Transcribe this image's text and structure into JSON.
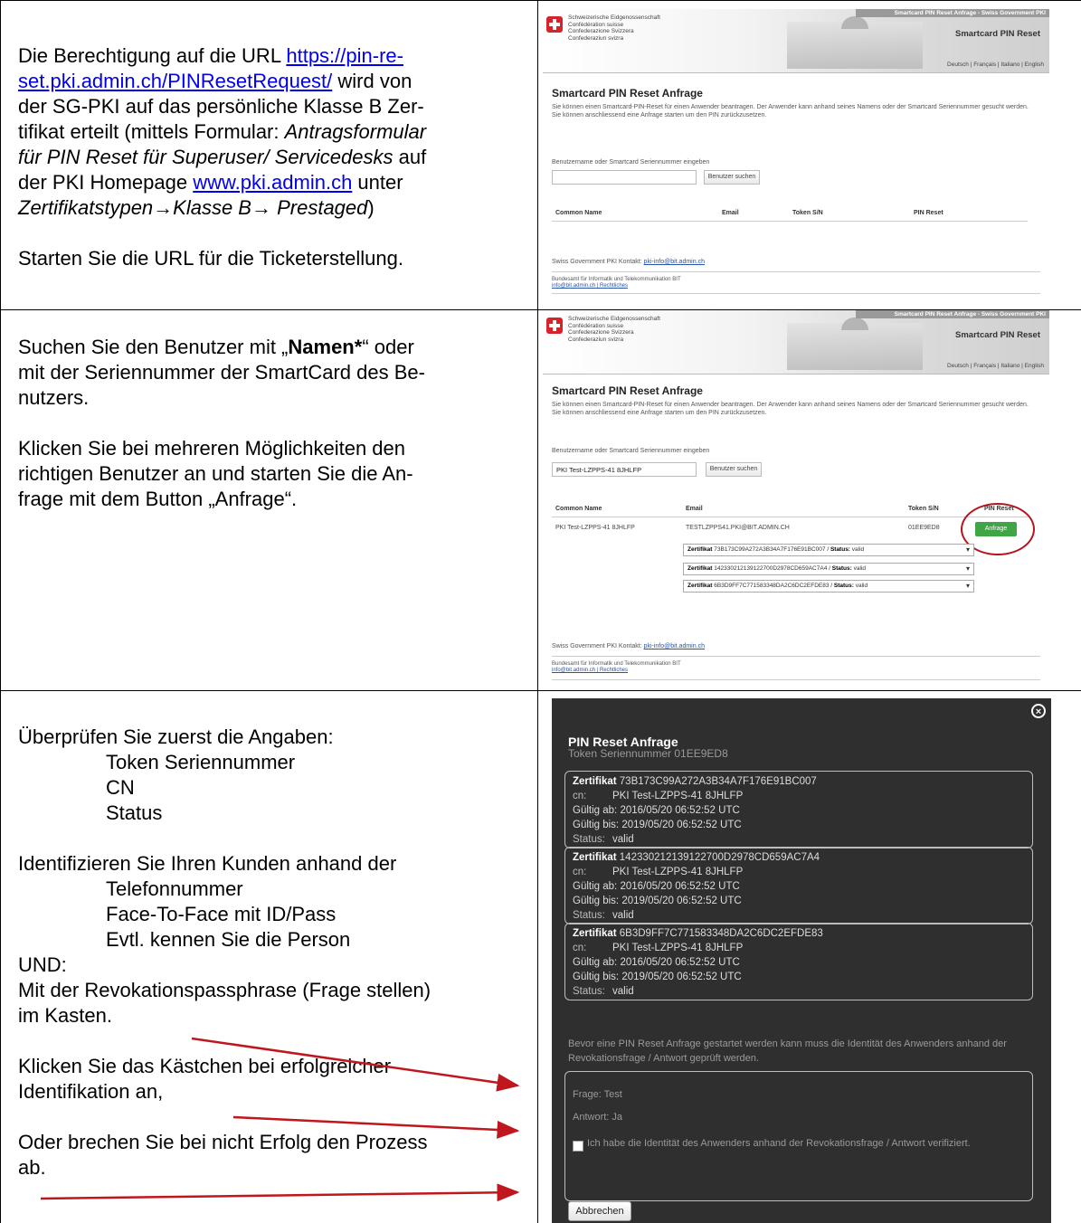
{
  "left": {
    "row1": {
      "line1_pre": "Die Berechtigung auf die URL ",
      "link1a": "https://pin-re-",
      "link1b": "set.pki.admin.ch/PINResetRequest/",
      "line2_post": " wird von",
      "line3": "der SG-PKI auf das persönliche Klasse B Zer-",
      "line4_pre": "tifikat erteilt (mittels Formular: ",
      "line4_em": "Antragsformular",
      "line5_em": "für PIN Reset für Superuser/ Servicedesks",
      "line5_post": " auf",
      "line6_pre": "der PKI Homepage ",
      "line6_link": "www.pki.admin.ch",
      "line6_post": " unter",
      "line7_em": "Zertifikatstypen→Klasse B→ Prestaged",
      "line7_post": ")",
      "line8": "Starten Sie die URL für die Ticketerstellung."
    },
    "row2": {
      "l1_pre": "Suchen Sie den Benutzer mit „",
      "l1_bold": "Namen*",
      "l1_post": "“ oder",
      "l2": "mit der Seriennummer der SmartCard des Be-",
      "l3": "nutzers.",
      "l4": "Klicken Sie bei mehreren Möglichkeiten den",
      "l5": "richtigen Benutzer an und starten Sie die An-",
      "l6": "frage mit dem Button „Anfrage“."
    },
    "row3": {
      "l1": "Überprüfen Sie zuerst die Angaben:",
      "l2": "Token Seriennummer",
      "l3": "CN",
      "l4": "Status",
      "l5": "Identifizieren Sie Ihren Kunden anhand der",
      "l6": "Telefonnummer",
      "l7": "Face-To-Face mit ID/Pass",
      "l8": "Evtl. kennen Sie die Person",
      "l9": "UND:",
      "l10": "Mit der Revokationspassphrase (Frage stellen)",
      "l11": "im Kasten.",
      "l12": "Klicken Sie das Kästchen bei erfolgreicher",
      "l13": "Identifikation an,",
      "l14": "Oder brechen Sie bei nicht Erfolg den Prozess",
      "l15": "ab."
    }
  },
  "portal": {
    "conf_lines": [
      "Schweizerische Eidgenossenschaft",
      "Confédération suisse",
      "Confederazione Svizzera",
      "Confederaziun svizra"
    ],
    "topbar": "Smartcard PIN Reset Anfrage - Swiss Government PKI",
    "app_title": "Smartcard PIN Reset",
    "langs": "Deutsch | Français | Italiano | English",
    "page_title": "Smartcard PIN Reset Anfrage",
    "desc1": "Sie können einen Smartcard-PIN-Reset für einen Anwender beantragen. Der Anwender kann anhand seines Namens oder der Smartcard Seriennummer gesucht werden. Sie können anschliessend eine Anfrage starten um den PIN zurückzusetzen.",
    "desc2": "Sie können einen Smartcard-PIN-Reset für einen Anwender beantragen. Der Anwender kann anhand seines Namens oder der Smartcard Seriennummer gesucht werden. Sie können anschliessend eine Anfrage starten um den PIN zurückzusetzen.",
    "search_label": "Benutzername oder Smartcard Seriennummer eingeben",
    "search_value": "PKI Test-LZPPS-41 8JHLFP",
    "search_button": "Benutzer suchen",
    "col_cn": "Common Name",
    "col_email": "Email",
    "col_token": "Token S/N",
    "col_pin": "PIN Reset",
    "result": {
      "cn": "PKI Test-LZPPS-41 8JHLFP",
      "email": "TESTLZPPS41.PKI@BIT.ADMIN.CH",
      "token": "01EE9ED8",
      "button": "Anfrage"
    },
    "certs": [
      {
        "label": "Zertifikat",
        "id": "73B173C99A272A3B34A7F176E91BC007",
        "status_label": "Status:",
        "status": "valid"
      },
      {
        "label": "Zertifikat",
        "id": "142330212139122700D2978CD659AC7A4",
        "status_label": "Status:",
        "status": "valid"
      },
      {
        "label": "Zertifikat",
        "id": "6B3D9FF7C771583348DA2C6DC2EFDE83",
        "status_label": "Status:",
        "status": "valid"
      }
    ],
    "contact_pre": "Swiss Government PKI Kontakt: ",
    "contact_link": "pki-info@bit.admin.ch",
    "footer_org": "Bundesamt für Informatik und Telekommunikation BIT",
    "footer_links": "info@bit.admin.ch | Rechtliches"
  },
  "modal": {
    "close": "×",
    "title": "PIN Reset Anfrage",
    "serial": "Token Seriennummer 01EE9ED8",
    "certs": [
      {
        "label": "Zertifikat",
        "id": "73B173C99A272A3B34A7F176E91BC007",
        "cn_k": "cn:",
        "cn": "PKI Test-LZPPS-41 8JHLFP",
        "from_k": "Gültig ab:",
        "from": "2016/05/20 06:52:52 UTC",
        "to_k": "Gültig bis:",
        "to": "2019/05/20 06:52:52 UTC",
        "st_k": "Status:",
        "st": "valid"
      },
      {
        "label": "Zertifikat",
        "id": "142330212139122700D2978CD659AC7A4",
        "cn_k": "cn:",
        "cn": "PKI Test-LZPPS-41 8JHLFP",
        "from_k": "Gültig ab:",
        "from": "2016/05/20 06:52:52 UTC",
        "to_k": "Gültig bis:",
        "to": "2019/05/20 06:52:52 UTC",
        "st_k": "Status:",
        "st": "valid"
      },
      {
        "label": "Zertifikat",
        "id": "6B3D9FF7C771583348DA2C6DC2EFDE83",
        "cn_k": "cn:",
        "cn": "PKI Test-LZPPS-41 8JHLFP",
        "from_k": "Gültig ab:",
        "from": "2016/05/20 06:52:52 UTC",
        "to_k": "Gültig bis:",
        "to": "2019/05/20 06:52:52 UTC",
        "st_k": "Status:",
        "st": "valid"
      }
    ],
    "notice": "Bevor eine PIN Reset Anfrage gestartet werden kann muss die Identität des Anwenders anhand der Revokationsfrage / Antwort geprüft werden.",
    "question": "Frage: Test",
    "answer": "Antwort: Ja",
    "checkbox_label": "Ich habe die Identität des Anwenders anhand der Revokationsfrage / Antwort verifiziert.",
    "cancel": "Abbrechen"
  },
  "colors": {
    "arrow": "#c0171f",
    "green": "#3fa646",
    "modal_bg": "#2f2f2f"
  }
}
